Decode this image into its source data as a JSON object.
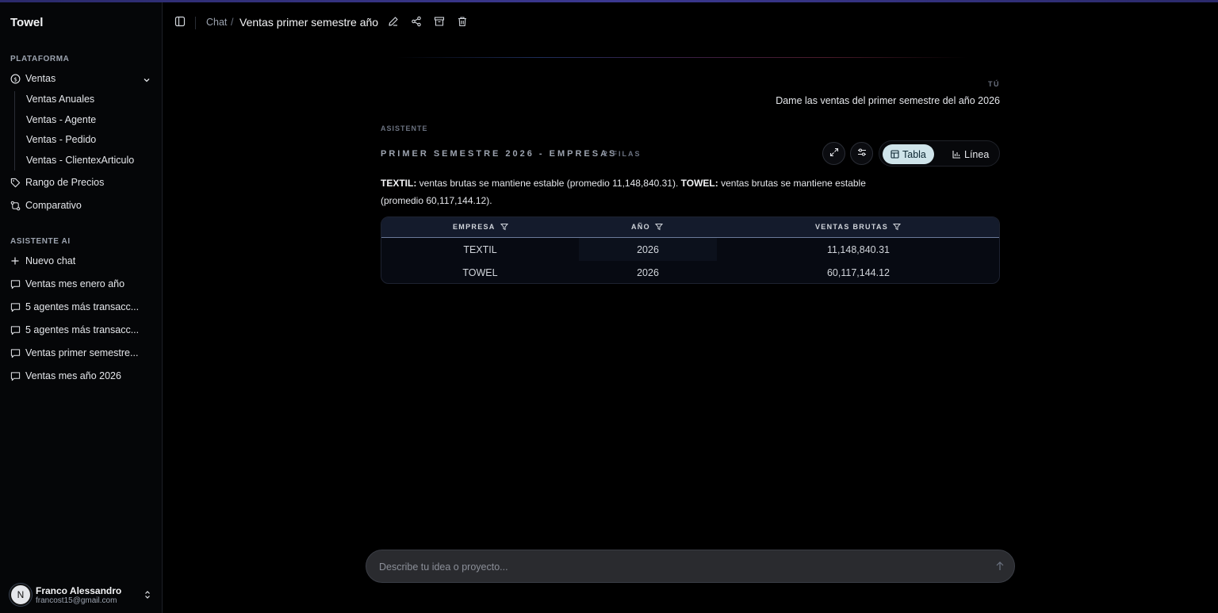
{
  "app": {
    "brand": "Towel"
  },
  "sidebar": {
    "platform_label": "PLATAFORMA",
    "ventas_label": "Ventas",
    "ventas_sub": [
      "Ventas Anuales",
      "Ventas - Agente",
      "Ventas - Pedido",
      "Ventas - ClientexArticulo"
    ],
    "rango_label": "Rango de Precios",
    "comparativo_label": "Comparativo",
    "ai_label": "ASISTENTE AI",
    "new_chat_label": "Nuevo chat",
    "chats": [
      "Ventas mes enero año",
      "5 agentes más transacc...",
      "5 agentes más transacc...",
      "Ventas primer semestre...",
      "Ventas mes año 2026"
    ]
  },
  "user": {
    "initial": "N",
    "name": "Franco Alessandro",
    "email": "francost15@gmail.com"
  },
  "header": {
    "breadcrumb_root": "Chat",
    "separator": "/",
    "title": "Ventas primer semestre año"
  },
  "conversation": {
    "user_label": "TÚ",
    "user_message": "Dame las ventas del primer semestre del año 2026",
    "assistant_label": "ASISTENTE",
    "result_title": "PRIMER SEMESTRE 2026 - EMPRESAS",
    "result_rows": "2 FILAS",
    "view_table_label": "Tabla",
    "view_line_label": "Línea",
    "summary_part1_bold": "TEXTIL:",
    "summary_part1": " ventas brutas se mantiene estable (promedio 11,148,840.31). ",
    "summary_part2_bold": "TOWEL:",
    "summary_part2": " ventas brutas se mantiene estable (promedio 60,117,144.12)."
  },
  "table": {
    "columns": [
      "EMPRESA",
      "AÑO",
      "VENTAS BRUTAS"
    ],
    "rows": [
      [
        "TEXTIL",
        "2026",
        "11,148,840.31"
      ],
      [
        "TOWEL",
        "2026",
        "60,117,144.12"
      ]
    ]
  },
  "composer": {
    "placeholder": "Describe tu idea o proyecto..."
  },
  "colors": {
    "background": "#000000",
    "sidebar": "#050608",
    "accent_active": "#cfe4ea",
    "table_header": "#141b2c"
  },
  "icons": [
    "dollar-circle-icon",
    "chevron-down-icon",
    "tag-icon",
    "compare-icon",
    "plus-icon",
    "message-icon",
    "sidebar-toggle-icon",
    "edit-icon",
    "share-icon",
    "archive-icon",
    "trash-icon",
    "expand-icon",
    "settings-icon",
    "table-icon",
    "bar-chart-icon",
    "filter-icon",
    "arrow-up-icon",
    "chevrons-updown-icon"
  ]
}
